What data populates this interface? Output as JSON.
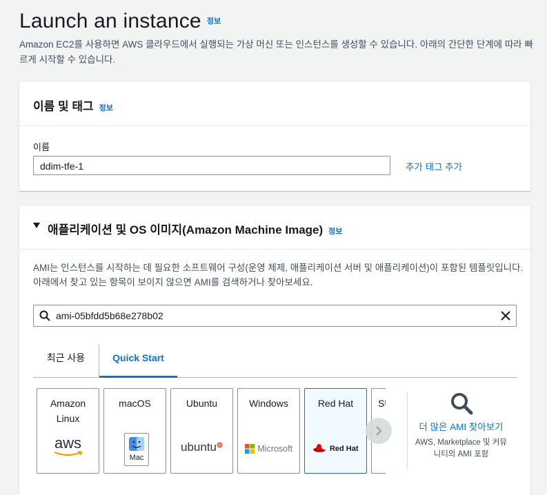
{
  "page": {
    "title": "Launch an instance",
    "info_link": "정보",
    "subtitle": "Amazon EC2를 사용하면 AWS 클라우드에서 실행되는 가상 머신 또는 인스턴스를 생성할 수 있습니다. 아래의 간단한 단계에 따라 빠르게 시작할 수 있습니다."
  },
  "name_panel": {
    "title": "이름 및 태그",
    "info_link": "정보",
    "field_label": "이름",
    "name_value": "ddim-tfe-1",
    "add_tag_link": "추가 태그 추가"
  },
  "ami_panel": {
    "title": "애플리케이션 및 OS 이미지(Amazon Machine Image)",
    "info_link": "정보",
    "description_line1": "AMI는 인스턴스를 시작하는 데 필요한 소프트웨어 구성(운영 체제, 애플리케이션 서버 및 애플리케이션)이 포함된 템플릿입니다.",
    "description_line2": "아래에서 찾고 있는 항목이 보이지 않으면 AMI를 검색하거나 찾아보세요.",
    "search_value": "ami-05bfdd5b68e278b02",
    "tabs": [
      {
        "label": "최근 사용",
        "active": false
      },
      {
        "label": "Quick Start",
        "active": true
      }
    ],
    "os_tiles": [
      {
        "name_line1": "Amazon",
        "name_line2": "Linux",
        "logo_text": "aws",
        "icon": "aws-logo"
      },
      {
        "name_line1": "macOS",
        "name_line2": "",
        "logo_text": "Mac",
        "icon": "finder-logo"
      },
      {
        "name_line1": "Ubuntu",
        "name_line2": "",
        "logo_text": "ubuntu",
        "icon": "ubuntu-logo"
      },
      {
        "name_line1": "Windows",
        "name_line2": "",
        "logo_text": "Microsoft",
        "icon": "microsoft-logo"
      },
      {
        "name_line1": "Red Hat",
        "name_line2": "",
        "logo_text": "Red Hat",
        "icon": "redhat-logo",
        "selected": true
      },
      {
        "name_line1": "SU",
        "name_line2": "",
        "logo_text": "",
        "icon": "suse-logo"
      }
    ],
    "more_ami_link": "더 많은 AMI 찾아보기",
    "more_ami_sub": "AWS, Marketplace 및 커뮤니티의 AMI 포함"
  },
  "colors": {
    "link": "#0972d3",
    "background": "#f2f3f3",
    "selected_tile_bg": "#f1faff",
    "aws_orange": "#ff9900",
    "ubuntu_orange": "#e95420",
    "redhat_red": "#ee0000"
  }
}
